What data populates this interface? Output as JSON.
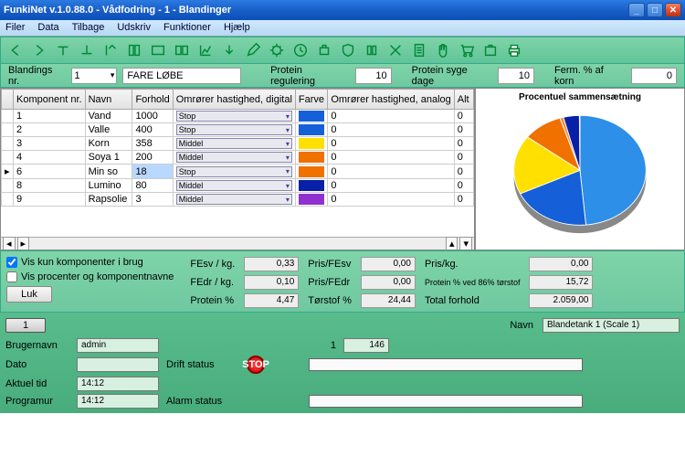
{
  "window": {
    "title": "FunkiNet v.1.0.88.0 - Vådfodring - 1 - Blandinger"
  },
  "menu": [
    "Filer",
    "Data",
    "Tilbage",
    "Udskriv",
    "Funktioner",
    "Hjælp"
  ],
  "params": {
    "bland_lbl": "Blandings nr.",
    "bland_val": "1",
    "desc": "FARE LØBE",
    "preg_lbl": "Protein regulering",
    "preg_val": "10",
    "psyg_lbl": "Protein syge dage",
    "psyg_val": "10",
    "ferm_lbl": "Ferm. % af korn",
    "ferm_val": "0"
  },
  "cols": [
    "",
    "Komponent nr.",
    "Navn",
    "Forhold",
    "Omrører hastighed, digital",
    "Farve",
    "Omrører hastighed, analog",
    "Alt"
  ],
  "rows": [
    {
      "nr": "1",
      "navn": "Vand",
      "forhold": "1000",
      "dig": "Stop",
      "farve": "#1560d8",
      "ana": "0",
      "alt": "0"
    },
    {
      "nr": "2",
      "navn": "Valle",
      "forhold": "400",
      "dig": "Stop",
      "farve": "#1560d8",
      "ana": "0",
      "alt": "0"
    },
    {
      "nr": "3",
      "navn": "Korn",
      "forhold": "358",
      "dig": "Middel",
      "farve": "#ffe000",
      "ana": "0",
      "alt": "0"
    },
    {
      "nr": "4",
      "navn": "Soya 1",
      "forhold": "200",
      "dig": "Middel",
      "farve": "#f07000",
      "ana": "0",
      "alt": "0"
    },
    {
      "nr": "6",
      "navn": "Min so",
      "forhold": "18",
      "dig": "Stop",
      "farve": "#f07000",
      "ana": "0",
      "alt": "0",
      "sel": true
    },
    {
      "nr": "8",
      "navn": "Lumino",
      "forhold": "80",
      "dig": "Middel",
      "farve": "#0820a8",
      "ana": "0",
      "alt": "0"
    },
    {
      "nr": "9",
      "navn": "Rapsolie",
      "forhold": "3",
      "dig": "Middel",
      "farve": "#9030d0",
      "ana": "0",
      "alt": "0"
    }
  ],
  "chart_title": "Procentuel sammensætning",
  "chart_data": {
    "type": "pie",
    "title": "Procentuel sammensætning",
    "series": [
      {
        "name": "Vand",
        "value": 1000,
        "color": "#2d8fe8"
      },
      {
        "name": "Valle",
        "value": 400,
        "color": "#1560d8"
      },
      {
        "name": "Korn",
        "value": 358,
        "color": "#ffe000"
      },
      {
        "name": "Soya 1",
        "value": 200,
        "color": "#f07000"
      },
      {
        "name": "Min so",
        "value": 18,
        "color": "#f59040"
      },
      {
        "name": "Lumino",
        "value": 80,
        "color": "#0820a8"
      },
      {
        "name": "Rapsolie",
        "value": 3,
        "color": "#1b6b55"
      }
    ]
  },
  "checks": {
    "c1": "Vis kun komponenter i brug",
    "c2": "Vis procenter og komponentnavne",
    "luk": "Luk"
  },
  "stats": {
    "fesv_l": "FEsv / kg.",
    "fesv": "0,33",
    "fedr_l": "FEdr / kg.",
    "fedr": "0,10",
    "prot_l": "Protein %",
    "prot": "4,47",
    "pfesv_l": "Pris/FEsv",
    "pfesv": "0,00",
    "pfedr_l": "Pris/FEdr",
    "pfedr": "0,00",
    "tor_l": "Tørstof %",
    "tor": "24,44",
    "pkg_l": "Pris/kg.",
    "pkg": "0,00",
    "p86_l": "Protein % ved 86% tørstof",
    "p86": "15,72",
    "tot_l": "Total forhold",
    "tot": "2.059,00"
  },
  "bottom": {
    "tab": "1",
    "navn_l": "Navn",
    "navn": "Blandetank 1 (Scale 1)",
    "bruger_l": "Brugernavn",
    "bruger": "admin",
    "dato_l": "Dato",
    "dato": "",
    "tid_l": "Aktuel tid",
    "tid": "14:12",
    "prog_l": "Programur",
    "prog": "14:12",
    "drift_l": "Drift status",
    "alarm_l": "Alarm status",
    "n1": "1",
    "n2": "146",
    "stop": "STOP"
  }
}
